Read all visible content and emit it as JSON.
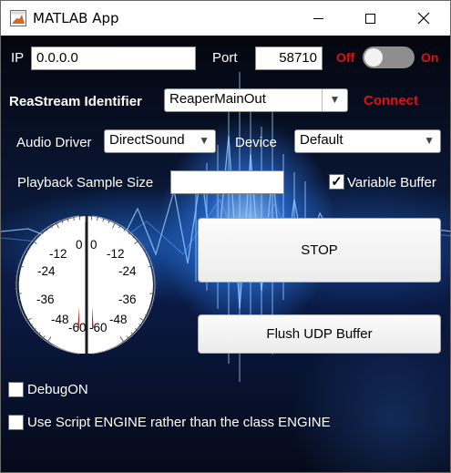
{
  "window": {
    "title": "MATLAB App"
  },
  "connection": {
    "ip_label": "IP",
    "ip_value": "0.0.0.0",
    "port_label": "Port",
    "port_value": "58710",
    "toggle_off_label": "Off",
    "toggle_on_label": "On",
    "toggle_state": "Off"
  },
  "reastream": {
    "identifier_label": "ReaStream Identifier",
    "identifier_value": "ReaperMainOut",
    "connect_label": "Connect"
  },
  "audio": {
    "driver_label": "Audio Driver",
    "driver_value": "DirectSound",
    "device_label": "Device",
    "device_value": "Default"
  },
  "playback": {
    "sample_size_label": "Playback Sample Size",
    "sample_size_value": "",
    "variable_buffer_label": "Variable Buffer",
    "variable_buffer_checked": true
  },
  "meter": {
    "ticks": [
      "0",
      "-12",
      "-24",
      "-36",
      "-48",
      "-60"
    ],
    "left_level_db": -60,
    "right_level_db": -60,
    "needle_color": "#c0281e"
  },
  "buttons": {
    "stop_label": "STOP",
    "flush_label": "Flush UDP Buffer"
  },
  "options": {
    "debug_label": "DebugON",
    "debug_checked": false,
    "script_engine_label": "Use Script ENGINE rather than the class ENGINE",
    "script_engine_checked": false
  },
  "colors": {
    "accent_red": "#e01010",
    "background": "#0a1838",
    "toggle_track": "#8e8e8e"
  }
}
